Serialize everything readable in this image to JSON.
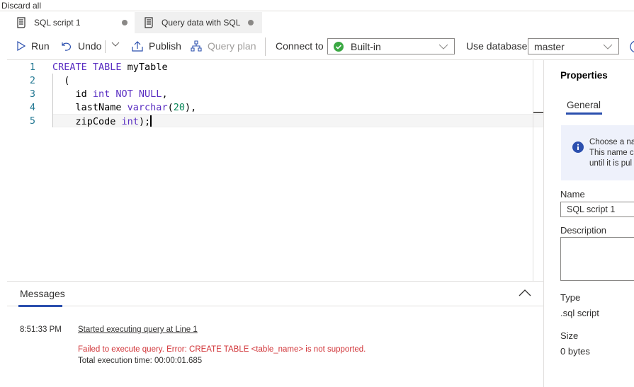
{
  "top": {
    "discard_label": "Discard all"
  },
  "tabs": [
    {
      "label": "SQL script 1",
      "icon": "script-icon",
      "active": true,
      "unsaved": true
    },
    {
      "label": "Query data with SQL",
      "icon": "script-icon",
      "active": false,
      "unsaved": true
    }
  ],
  "toolbar": {
    "run": "Run",
    "undo": "Undo",
    "publish": "Publish",
    "query_plan": "Query plan",
    "connect_to_label": "Connect to",
    "connect_to_value": "Built-in",
    "use_database_label": "Use database",
    "use_database_value": "master"
  },
  "editor": {
    "line_numbers": [
      "1",
      "2",
      "3",
      "4",
      "5"
    ],
    "current_line": 5
  },
  "messages": {
    "tab_label": "Messages",
    "time": "8:51:33 PM",
    "started": "Started executing query at Line 1",
    "error": "Failed to execute query. Error: CREATE TABLE <table_name> is not supported.",
    "total": "Total execution time: 00:00:01.685"
  },
  "properties": {
    "title": "Properties",
    "tab": "General",
    "info_lines": [
      "Choose a na",
      "This name ca",
      "until it is pul"
    ],
    "name_label": "Name",
    "name_value": "SQL script 1",
    "description_label": "Description",
    "description_value": "",
    "type_label": "Type",
    "type_value": ".sql script",
    "size_label": "Size",
    "size_value": "0 bytes"
  },
  "colors": {
    "accent": "#2b4fae",
    "error": "#d13438",
    "keyword": "#5a2fc2",
    "number": "#098658",
    "success": "#3aa843"
  }
}
